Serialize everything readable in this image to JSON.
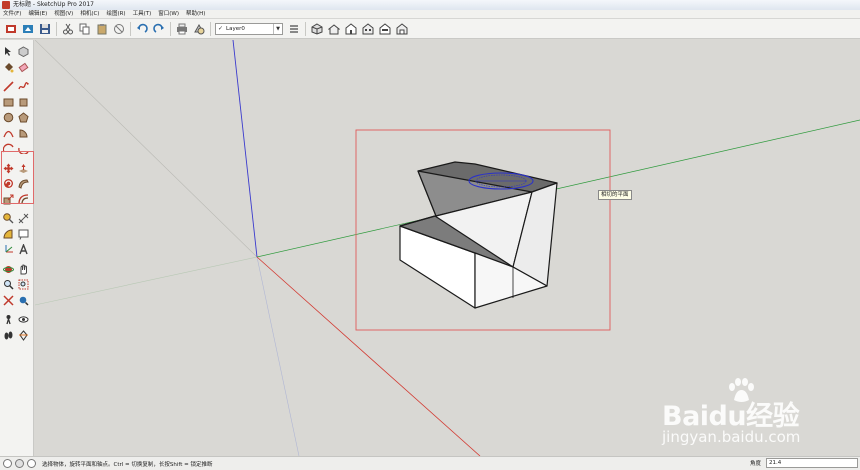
{
  "window": {
    "title": "无标题 - SketchUp Pro 2017"
  },
  "menu": {
    "items": [
      "文件(F)",
      "编辑(E)",
      "视图(V)",
      "相机(C)",
      "绘图(R)",
      "工具(T)",
      "窗口(W)",
      "帮助(H)"
    ]
  },
  "toolbar": {
    "layer": {
      "check": "✓",
      "value": "Layer0",
      "arrow": "▼"
    },
    "icons": [
      "get-models-icon",
      "share-model-icon",
      "save-icon",
      "cut-icon",
      "copy-icon",
      "paste-icon",
      "erase-icon",
      "undo-icon",
      "redo-icon",
      "print-icon",
      "model-info-icon",
      "layer-manager-icon",
      "iso-view-icon",
      "top-view-icon",
      "front-view-icon",
      "right-view-icon",
      "back-view-icon",
      "left-view-icon"
    ]
  },
  "left_toolbar": {
    "icons": [
      [
        "select-icon",
        "component-icon"
      ],
      [
        "paint-bucket-icon",
        "eraser-icon"
      ],
      [
        "line-icon",
        "freehand-icon"
      ],
      [
        "rectangle-icon",
        "rotated-rectangle-icon"
      ],
      [
        "circle-icon",
        "polygon-icon"
      ],
      [
        "arc-icon",
        "pie-icon"
      ],
      [
        "two-point-arc-icon",
        "three-point-arc-icon"
      ],
      [
        "move-icon",
        "push-pull-icon"
      ],
      [
        "rotate-icon",
        "follow-me-icon"
      ],
      [
        "scale-icon",
        "offset-icon"
      ],
      [
        "tape-measure-icon",
        "dimension-icon"
      ],
      [
        "protractor-icon",
        "text-icon"
      ],
      [
        "axes-icon",
        "3d-text-icon"
      ],
      [
        "orbit-icon",
        "pan-icon"
      ],
      [
        "zoom-icon",
        "zoom-window-icon"
      ],
      [
        "zoom-extents-icon",
        "previous-view-icon"
      ],
      [
        "position-camera-icon",
        "look-around-icon"
      ],
      [
        "walk-icon",
        "section-plane-icon"
      ]
    ]
  },
  "viewport": {
    "tooltip": "相切的平面"
  },
  "status": {
    "text": "选择物体，旋转平面和轴点。Ctrl = 切换复制，长按Shift = 锁定推断",
    "angle_label": "角度",
    "angle_value": "21.4"
  },
  "watermark": {
    "logo": "Baidu经验",
    "url": "jingyan.baidu.com"
  }
}
